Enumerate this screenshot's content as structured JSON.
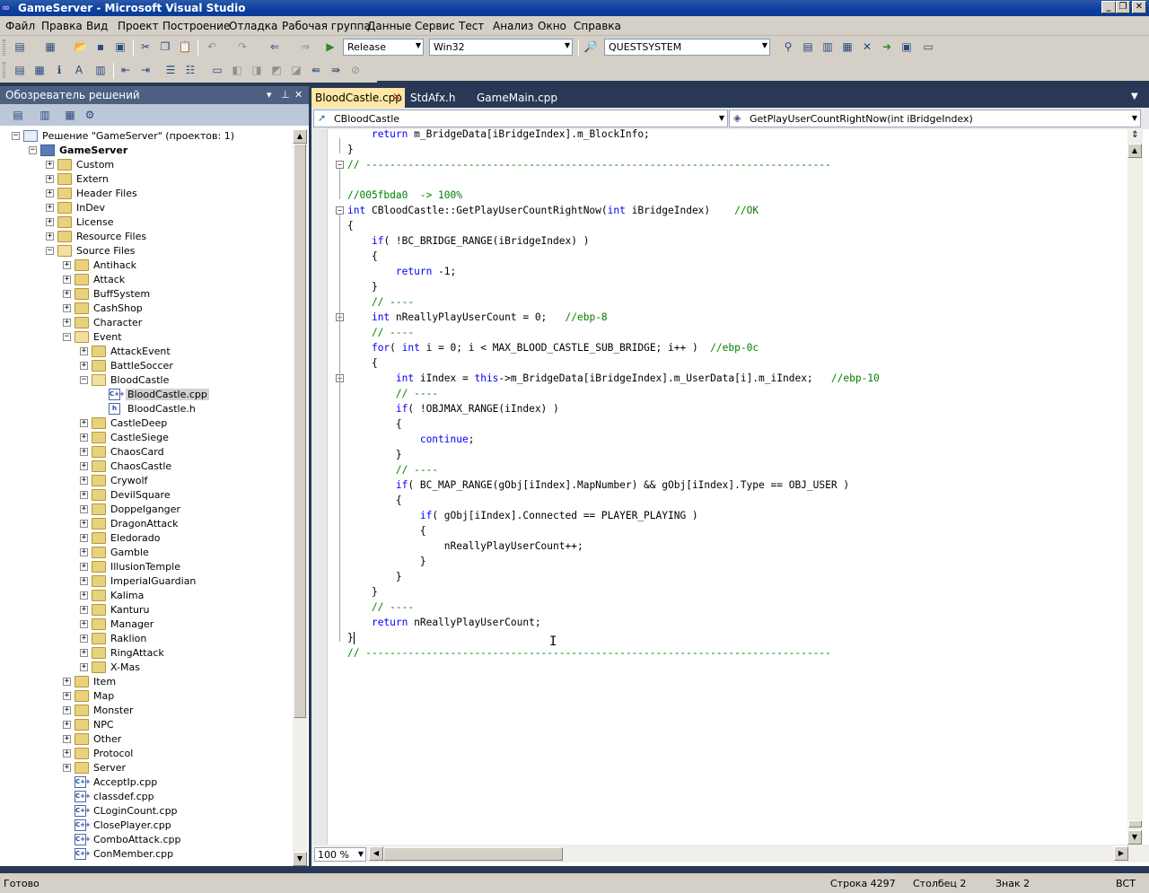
{
  "window": {
    "title": "GameServer - Microsoft Visual Studio",
    "minimize": "_",
    "restore": "❐",
    "close": "✕"
  },
  "menu": [
    "Файл",
    "Правка",
    "Вид",
    "Проект",
    "Построение",
    "Отладка",
    "Рабочая группа",
    "Данные",
    "Сервис",
    "Тест",
    "Анализ",
    "Окно",
    "Справка"
  ],
  "toolbar": {
    "config": "Release",
    "platform": "Win32",
    "find_value": "QUESTSYSTEM"
  },
  "solution_explorer": {
    "title": "Обозреватель решений",
    "nodes": [
      {
        "label": "Решение \"GameServer\" (проектов: 1)",
        "indent": 0,
        "type": "solution",
        "exp": "-"
      },
      {
        "label": "GameServer",
        "indent": 1,
        "type": "project",
        "exp": "-",
        "bold": true
      },
      {
        "label": "Custom",
        "indent": 2,
        "type": "folder",
        "exp": "+"
      },
      {
        "label": "Extern",
        "indent": 2,
        "type": "folder",
        "exp": "+"
      },
      {
        "label": "Header Files",
        "indent": 2,
        "type": "folder",
        "exp": "+"
      },
      {
        "label": "InDev",
        "indent": 2,
        "type": "folder",
        "exp": "+"
      },
      {
        "label": "License",
        "indent": 2,
        "type": "folder",
        "exp": "+"
      },
      {
        "label": "Resource Files",
        "indent": 2,
        "type": "folder",
        "exp": "+"
      },
      {
        "label": "Source Files",
        "indent": 2,
        "type": "folder-open",
        "exp": "-"
      },
      {
        "label": "Antihack",
        "indent": 3,
        "type": "folder",
        "exp": "+"
      },
      {
        "label": "Attack",
        "indent": 3,
        "type": "folder",
        "exp": "+"
      },
      {
        "label": "BuffSystem",
        "indent": 3,
        "type": "folder",
        "exp": "+"
      },
      {
        "label": "CashShop",
        "indent": 3,
        "type": "folder",
        "exp": "+"
      },
      {
        "label": "Character",
        "indent": 3,
        "type": "folder",
        "exp": "+"
      },
      {
        "label": "Event",
        "indent": 3,
        "type": "folder-open",
        "exp": "-"
      },
      {
        "label": "AttackEvent",
        "indent": 4,
        "type": "folder",
        "exp": "+"
      },
      {
        "label": "BattleSoccer",
        "indent": 4,
        "type": "folder",
        "exp": "+"
      },
      {
        "label": "BloodCastle",
        "indent": 4,
        "type": "folder-open",
        "exp": "-"
      },
      {
        "label": "BloodCastle.cpp",
        "indent": 5,
        "type": "cpp",
        "exp": "",
        "selected": true
      },
      {
        "label": "BloodCastle.h",
        "indent": 5,
        "type": "h",
        "exp": ""
      },
      {
        "label": "CastleDeep",
        "indent": 4,
        "type": "folder",
        "exp": "+"
      },
      {
        "label": "CastleSiege",
        "indent": 4,
        "type": "folder",
        "exp": "+"
      },
      {
        "label": "ChaosCard",
        "indent": 4,
        "type": "folder",
        "exp": "+"
      },
      {
        "label": "ChaosCastle",
        "indent": 4,
        "type": "folder",
        "exp": "+"
      },
      {
        "label": "Crywolf",
        "indent": 4,
        "type": "folder",
        "exp": "+"
      },
      {
        "label": "DevilSquare",
        "indent": 4,
        "type": "folder",
        "exp": "+"
      },
      {
        "label": "Doppelganger",
        "indent": 4,
        "type": "folder",
        "exp": "+"
      },
      {
        "label": "DragonAttack",
        "indent": 4,
        "type": "folder",
        "exp": "+"
      },
      {
        "label": "Eledorado",
        "indent": 4,
        "type": "folder",
        "exp": "+"
      },
      {
        "label": "Gamble",
        "indent": 4,
        "type": "folder",
        "exp": "+"
      },
      {
        "label": "IllusionTemple",
        "indent": 4,
        "type": "folder",
        "exp": "+"
      },
      {
        "label": "ImperialGuardian",
        "indent": 4,
        "type": "folder",
        "exp": "+"
      },
      {
        "label": "Kalima",
        "indent": 4,
        "type": "folder",
        "exp": "+"
      },
      {
        "label": "Kanturu",
        "indent": 4,
        "type": "folder",
        "exp": "+"
      },
      {
        "label": "Manager",
        "indent": 4,
        "type": "folder",
        "exp": "+"
      },
      {
        "label": "Raklion",
        "indent": 4,
        "type": "folder",
        "exp": "+"
      },
      {
        "label": "RingAttack",
        "indent": 4,
        "type": "folder",
        "exp": "+"
      },
      {
        "label": "X-Mas",
        "indent": 4,
        "type": "folder",
        "exp": "+"
      },
      {
        "label": "Item",
        "indent": 3,
        "type": "folder",
        "exp": "+"
      },
      {
        "label": "Map",
        "indent": 3,
        "type": "folder",
        "exp": "+"
      },
      {
        "label": "Monster",
        "indent": 3,
        "type": "folder",
        "exp": "+"
      },
      {
        "label": "NPC",
        "indent": 3,
        "type": "folder",
        "exp": "+"
      },
      {
        "label": "Other",
        "indent": 3,
        "type": "folder",
        "exp": "+"
      },
      {
        "label": "Protocol",
        "indent": 3,
        "type": "folder",
        "exp": "+"
      },
      {
        "label": "Server",
        "indent": 3,
        "type": "folder",
        "exp": "+"
      },
      {
        "label": "AcceptIp.cpp",
        "indent": 3,
        "type": "cpp",
        "exp": ""
      },
      {
        "label": "classdef.cpp",
        "indent": 3,
        "type": "cpp",
        "exp": ""
      },
      {
        "label": "CLoginCount.cpp",
        "indent": 3,
        "type": "cpp",
        "exp": ""
      },
      {
        "label": "ClosePlayer.cpp",
        "indent": 3,
        "type": "cpp",
        "exp": ""
      },
      {
        "label": "ComboAttack.cpp",
        "indent": 3,
        "type": "cpp",
        "exp": ""
      },
      {
        "label": "ConMember.cpp",
        "indent": 3,
        "type": "cpp",
        "exp": ""
      }
    ]
  },
  "editor": {
    "tabs": [
      "BloodCastle.cpp",
      "StdAfx.h",
      "GameMain.cpp"
    ],
    "class_combo": "CBloodCastle",
    "member_combo": "GetPlayUserCountRightNow(int iBridgeIndex)",
    "zoom": "100 %",
    "lines": [
      [
        [
          "tx",
          "    "
        ],
        [
          "kw",
          "return"
        ],
        [
          "tx",
          " m_BridgeData[iBridgeIndex].m_BlockInfo;"
        ]
      ],
      [
        [
          "tx",
          "}"
        ]
      ],
      [
        [
          "cm",
          "// -----------------------------------------------------------------------------"
        ]
      ],
      [
        [
          "tx",
          ""
        ]
      ],
      [
        [
          "cm",
          "//005fbda0  -> 100%"
        ]
      ],
      [
        [
          "kw",
          "int"
        ],
        [
          "tx",
          " CBloodCastle::GetPlayUserCountRightNow("
        ],
        [
          "kw",
          "int"
        ],
        [
          "tx",
          " iBridgeIndex)    "
        ],
        [
          "cm",
          "//OK"
        ]
      ],
      [
        [
          "tx",
          "{"
        ]
      ],
      [
        [
          "tx",
          "    "
        ],
        [
          "kw",
          "if"
        ],
        [
          "tx",
          "( !BC_BRIDGE_RANGE(iBridgeIndex) )"
        ]
      ],
      [
        [
          "tx",
          "    {"
        ]
      ],
      [
        [
          "tx",
          "        "
        ],
        [
          "kw",
          "return"
        ],
        [
          "tx",
          " -1;"
        ]
      ],
      [
        [
          "tx",
          "    }"
        ]
      ],
      [
        [
          "cm",
          "    // ----"
        ]
      ],
      [
        [
          "tx",
          "    "
        ],
        [
          "kw",
          "int"
        ],
        [
          "tx",
          " nReallyPlayUserCount = 0;   "
        ],
        [
          "cm",
          "//ebp-8"
        ]
      ],
      [
        [
          "cm",
          "    // ----"
        ]
      ],
      [
        [
          "tx",
          "    "
        ],
        [
          "kw",
          "for"
        ],
        [
          "tx",
          "( "
        ],
        [
          "kw",
          "int"
        ],
        [
          "tx",
          " i = 0; i < MAX_BLOOD_CASTLE_SUB_BRIDGE; i++ )  "
        ],
        [
          "cm",
          "//ebp-0c"
        ]
      ],
      [
        [
          "tx",
          "    {"
        ]
      ],
      [
        [
          "tx",
          "        "
        ],
        [
          "kw",
          "int"
        ],
        [
          "tx",
          " iIndex = "
        ],
        [
          "kw",
          "this"
        ],
        [
          "tx",
          "->m_BridgeData[iBridgeIndex].m_UserData[i].m_iIndex;   "
        ],
        [
          "cm",
          "//ebp-10"
        ]
      ],
      [
        [
          "cm",
          "        // ----"
        ]
      ],
      [
        [
          "tx",
          "        "
        ],
        [
          "kw",
          "if"
        ],
        [
          "tx",
          "( !OBJMAX_RANGE(iIndex) )"
        ]
      ],
      [
        [
          "tx",
          "        {"
        ]
      ],
      [
        [
          "tx",
          "            "
        ],
        [
          "kw",
          "continue"
        ],
        [
          "tx",
          ";"
        ]
      ],
      [
        [
          "tx",
          "        }"
        ]
      ],
      [
        [
          "cm",
          "        // ----"
        ]
      ],
      [
        [
          "tx",
          "        "
        ],
        [
          "kw",
          "if"
        ],
        [
          "tx",
          "( BC_MAP_RANGE(gObj[iIndex].MapNumber) && gObj[iIndex].Type == OBJ_USER )"
        ]
      ],
      [
        [
          "tx",
          "        {"
        ]
      ],
      [
        [
          "tx",
          "            "
        ],
        [
          "kw",
          "if"
        ],
        [
          "tx",
          "( gObj[iIndex].Connected == PLAYER_PLAYING )"
        ]
      ],
      [
        [
          "tx",
          "            {"
        ]
      ],
      [
        [
          "tx",
          "                nReallyPlayUserCount++;"
        ]
      ],
      [
        [
          "tx",
          "            }"
        ]
      ],
      [
        [
          "tx",
          "        }"
        ]
      ],
      [
        [
          "tx",
          "    }"
        ]
      ],
      [
        [
          "cm",
          "    // ----"
        ]
      ],
      [
        [
          "tx",
          "    "
        ],
        [
          "kw",
          "return"
        ],
        [
          "tx",
          " nReallyPlayUserCount;"
        ]
      ],
      [
        [
          "tx",
          "}"
        ]
      ],
      [
        [
          "cm",
          "// -----------------------------------------------------------------------------"
        ]
      ]
    ]
  },
  "status": {
    "ready": "Готово",
    "line": "Строка 4297",
    "col": "Столбец 2",
    "ch": "Знак 2",
    "ins": "ВСТ"
  }
}
